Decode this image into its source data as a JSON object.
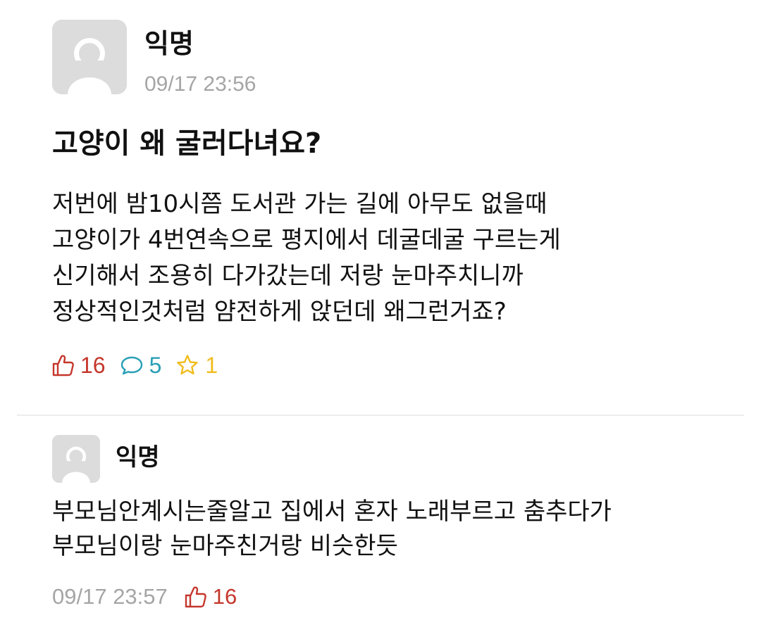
{
  "post": {
    "avatar_icon": "default-profile-icon",
    "author": "익명",
    "timestamp": "09/17 23:56",
    "title": "고양이 왜 굴러다녀요?",
    "body_lines": [
      "저번에 밤10시쯤 도서관 가는 길에 아무도 없을때",
      "고양이가 4번연속으로 평지에서 데굴데굴 구르는게",
      "신기해서 조용히 다가갔는데 저랑 눈마주치니까",
      "정상적인것처럼 얌전하게 앉던데 왜그런거죠?"
    ],
    "stats": {
      "likes": "16",
      "comments": "5",
      "scraps": "1",
      "like_icon": "thumbs-up-icon",
      "comment_icon": "speech-bubble-icon",
      "scrap_icon": "star-icon"
    }
  },
  "comment": {
    "avatar_icon": "default-profile-icon",
    "author": "익명",
    "body_lines": [
      "부모님안계시는줄알고 집에서 혼자 노래부르고 춤추다가",
      "부모님이랑 눈마주친거랑 비슷한듯"
    ],
    "timestamp": "09/17 23:57",
    "likes": "16",
    "like_icon": "thumbs-up-icon"
  },
  "colors": {
    "like": "#c5372c",
    "comment": "#2a9fb6",
    "scrap": "#f0bc1c",
    "meta_text": "#a5a5a5",
    "avatar_bg": "#dcdcdc"
  }
}
